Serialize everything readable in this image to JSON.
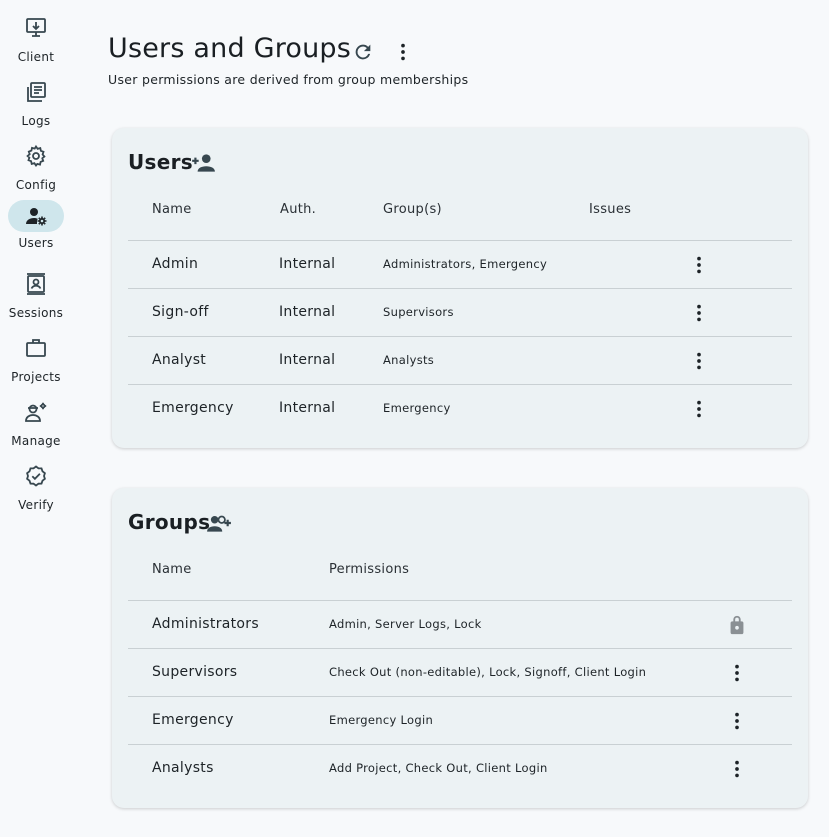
{
  "sidebar": {
    "items": [
      {
        "label": "Client",
        "icon": "download-to-computer-icon"
      },
      {
        "label": "Logs",
        "icon": "library-books-icon"
      },
      {
        "label": "Config",
        "icon": "gear-icon"
      },
      {
        "label": "Users",
        "icon": "manage-accounts-icon",
        "active": true
      },
      {
        "label": "Sessions",
        "icon": "contact-card-icon"
      },
      {
        "label": "Projects",
        "icon": "briefcase-icon"
      },
      {
        "label": "Manage",
        "icon": "engineering-icon"
      },
      {
        "label": "Verify",
        "icon": "verified-badge-icon"
      }
    ]
  },
  "header": {
    "title": "Users and Groups",
    "subtitle": "User permissions are derived from group memberships"
  },
  "users": {
    "title": "Users",
    "columns": {
      "name": "Name",
      "auth": "Auth.",
      "groups": "Group(s)",
      "issues": "Issues"
    },
    "rows": [
      {
        "name": "Admin",
        "auth": "Internal",
        "groups": "Administrators, Emergency",
        "issues": ""
      },
      {
        "name": "Sign-off",
        "auth": "Internal",
        "groups": "Supervisors",
        "issues": ""
      },
      {
        "name": "Analyst",
        "auth": "Internal",
        "groups": "Analysts",
        "issues": ""
      },
      {
        "name": "Emergency",
        "auth": "Internal",
        "groups": "Emergency",
        "issues": ""
      }
    ]
  },
  "groups": {
    "title": "Groups",
    "columns": {
      "name": "Name",
      "permissions": "Permissions"
    },
    "rows": [
      {
        "name": "Administrators",
        "permissions": "Admin, Server Logs, Lock",
        "locked": true
      },
      {
        "name": "Supervisors",
        "permissions": "Check Out (non-editable), Lock, Signoff, Client Login",
        "locked": false
      },
      {
        "name": "Emergency",
        "permissions": "Emergency Login",
        "locked": false
      },
      {
        "name": "Analysts",
        "permissions": "Add Project, Check Out, Client Login",
        "locked": false
      }
    ]
  },
  "colors": {
    "icon": "#37474f",
    "active_nav": "#cfe6ec",
    "card": "#ecf2f4",
    "lock": "#8a9094"
  }
}
